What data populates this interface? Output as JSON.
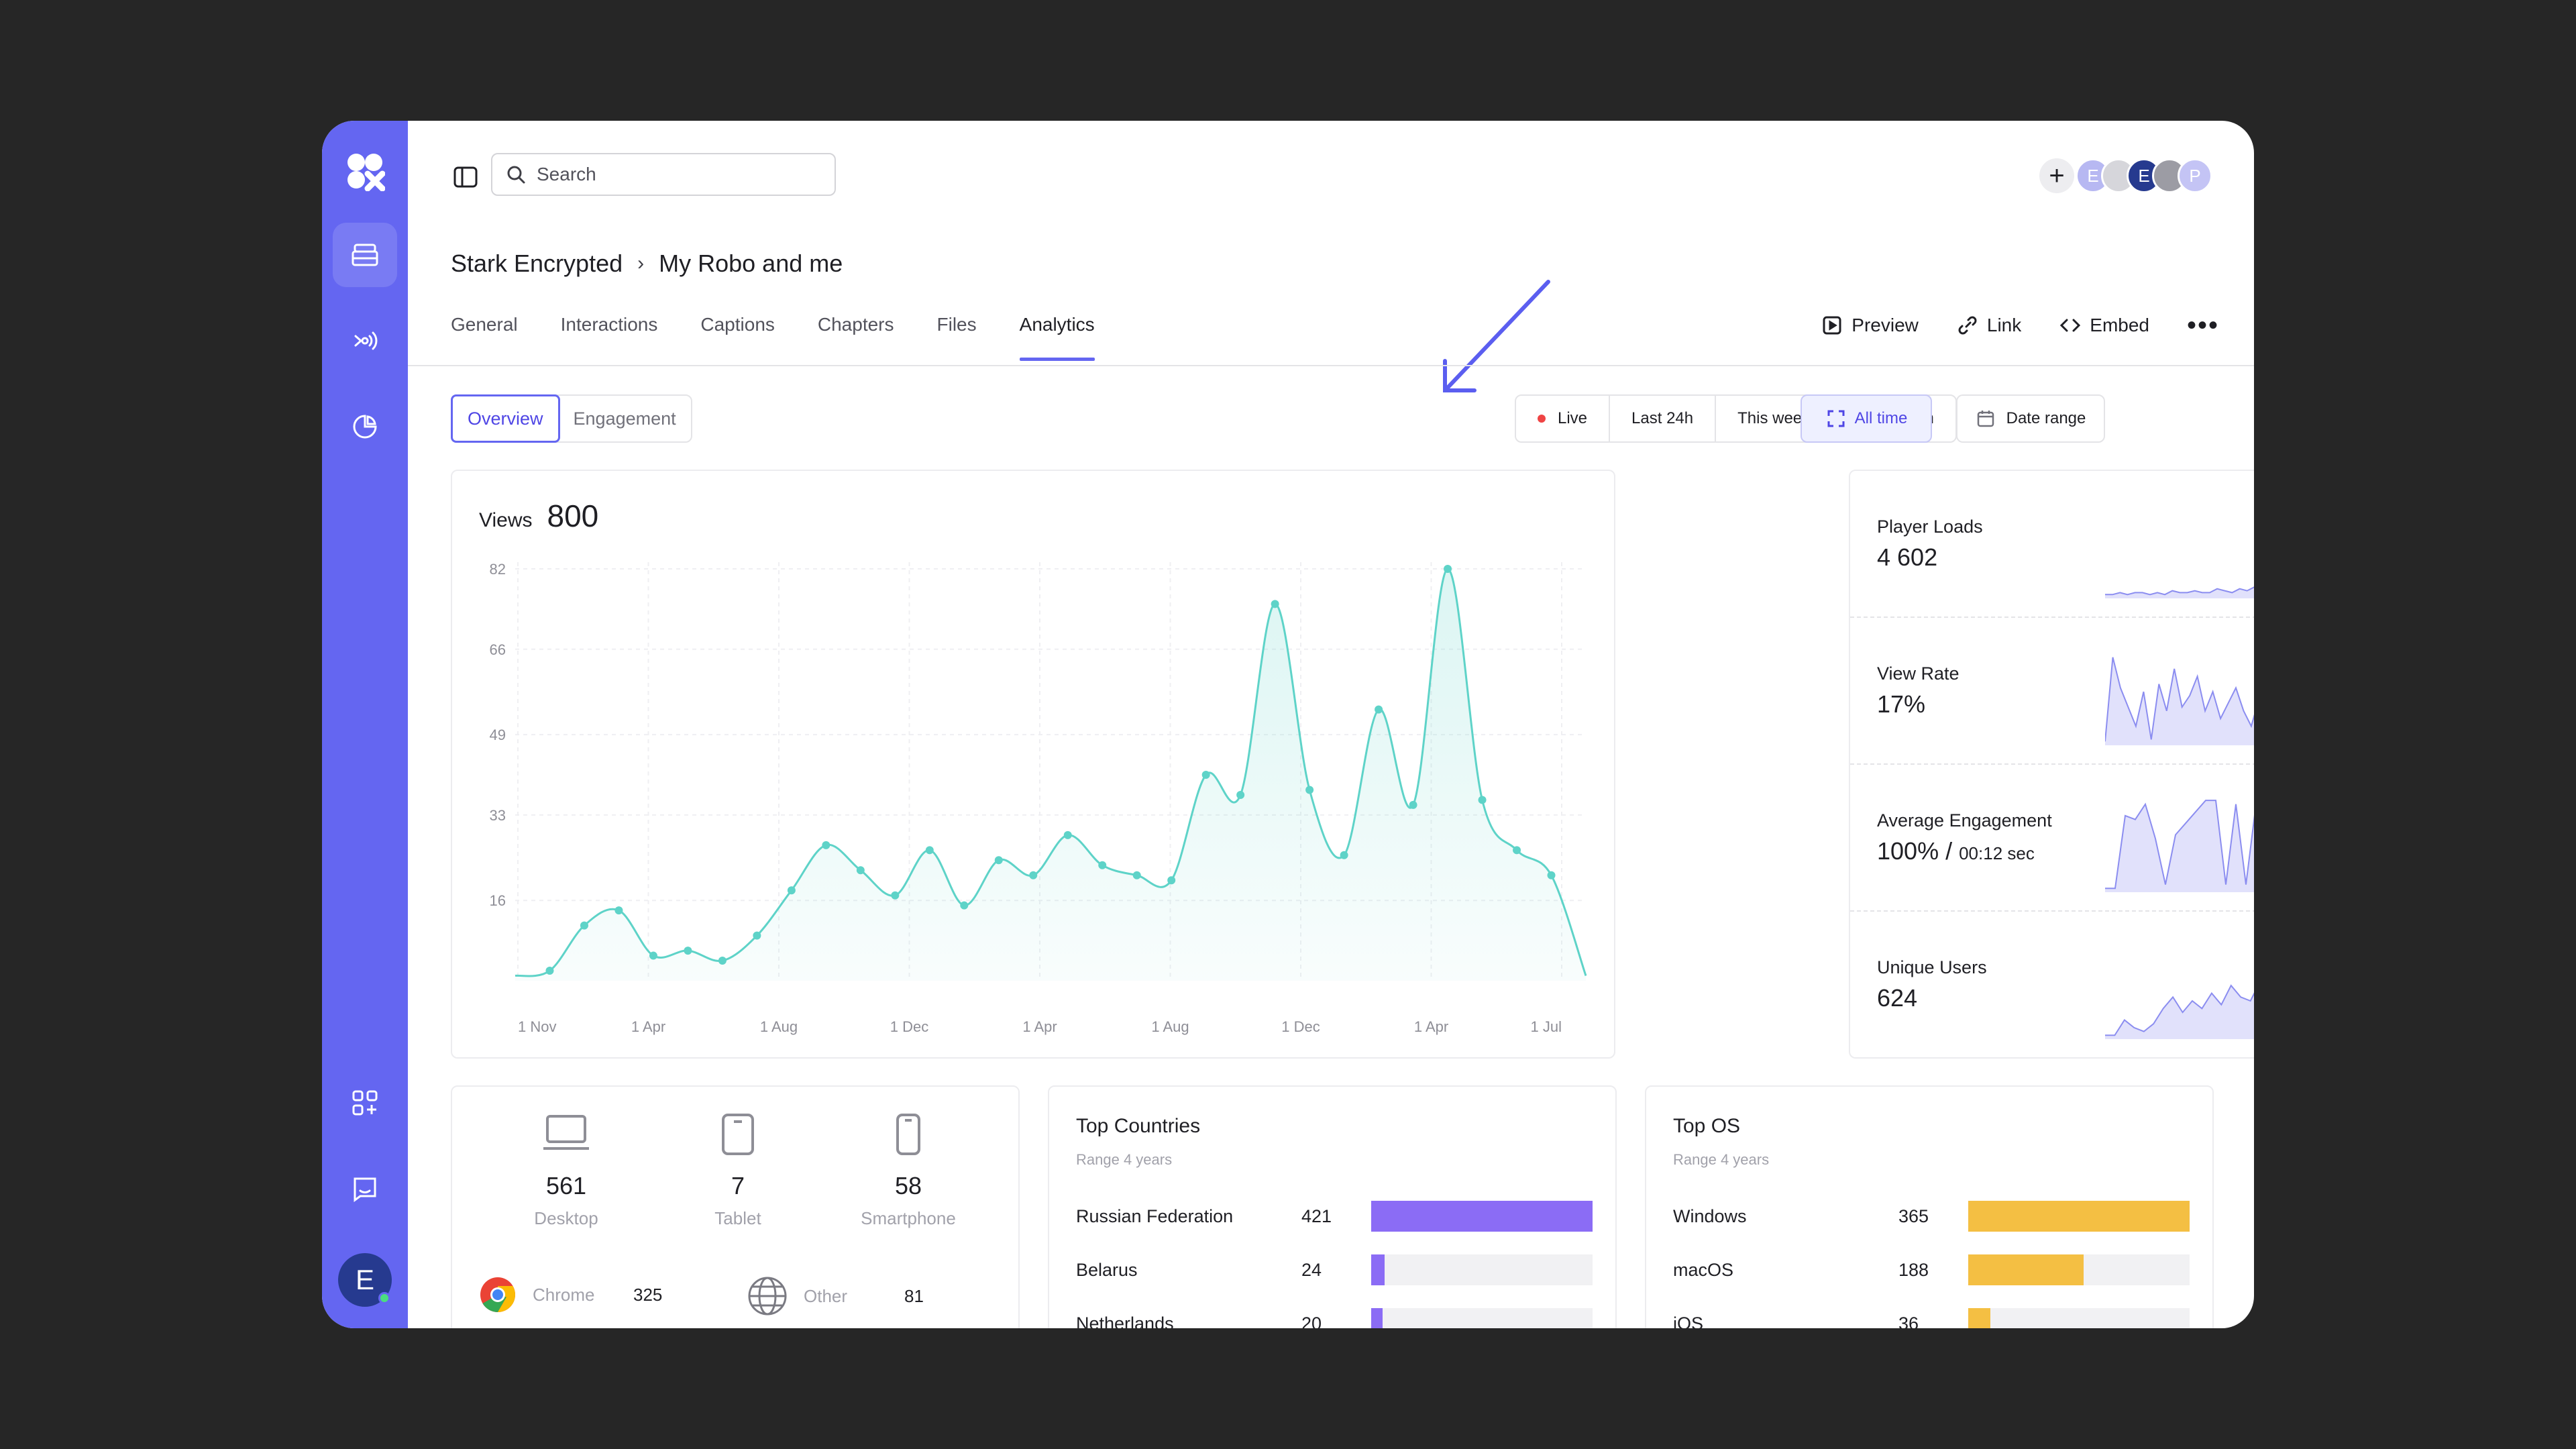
{
  "search": {
    "placeholder": "Search"
  },
  "collaborators": [
    "E",
    "E",
    "P"
  ],
  "breadcrumb": [
    "Stark Encrypted",
    "My Robo and me"
  ],
  "tabs": [
    "General",
    "Interactions",
    "Captions",
    "Chapters",
    "Files",
    "Analytics"
  ],
  "active_tab": "Analytics",
  "actions": {
    "preview": "Preview",
    "link": "Link",
    "embed": "Embed"
  },
  "subtabs": [
    "Overview",
    "Engagement"
  ],
  "ranges": [
    "Live",
    "Last 24h",
    "This week",
    "This month"
  ],
  "all_time": "All time",
  "date_range": "Date range",
  "user_initial": "E",
  "accent": "#6466f1",
  "views": {
    "label": "Views",
    "total": "800"
  },
  "chart_data": {
    "type": "area",
    "x_ticks": [
      "1 Nov",
      "1 Apr",
      "1 Aug",
      "1 Dec",
      "1 Apr",
      "1 Aug",
      "1 Dec",
      "1 Apr",
      "1 Jul"
    ],
    "y_ticks": [
      82,
      66,
      49,
      33,
      16
    ],
    "ylim": [
      0,
      82
    ],
    "values": [
      1,
      2,
      11,
      14,
      5,
      6,
      4,
      9,
      18,
      27,
      22,
      17,
      26,
      15,
      24,
      21,
      29,
      23,
      21,
      20,
      41,
      37,
      75,
      38,
      25,
      54,
      35,
      82,
      36,
      26,
      21,
      1
    ],
    "color": "#5ed3c8",
    "grid": true
  },
  "metrics": [
    {
      "label": "Player Loads",
      "value": "4 602",
      "suffix": ""
    },
    {
      "label": "View Rate",
      "value": "17%",
      "suffix": ""
    },
    {
      "label": "Average Engagement",
      "value": "100% /",
      "suffix": "00:12 sec"
    },
    {
      "label": "Unique Users",
      "value": "624",
      "suffix": ""
    }
  ],
  "devices": [
    {
      "count": "561",
      "label": "Desktop",
      "icon": "desktop-icon"
    },
    {
      "count": "7",
      "label": "Tablet",
      "icon": "tablet-icon"
    },
    {
      "count": "58",
      "label": "Smartphone",
      "icon": "smartphone-icon"
    }
  ],
  "browsers": [
    {
      "name": "Chrome",
      "count": "325",
      "icon": "chrome-icon"
    },
    {
      "name": "Other",
      "count": "81",
      "icon": "globe-icon"
    }
  ],
  "countries": {
    "title": "Top Countries",
    "subtitle": "Range 4 years",
    "color": "#8b6cf5",
    "rows": [
      {
        "name": "Russian Federation",
        "value": "421",
        "share": 1.0
      },
      {
        "name": "Belarus",
        "value": "24",
        "share": 0.06
      },
      {
        "name": "Netherlands",
        "value": "20",
        "share": 0.05
      }
    ]
  },
  "os": {
    "title": "Top OS",
    "subtitle": "Range 4 years",
    "color": "#f4bf43",
    "rows": [
      {
        "name": "Windows",
        "value": "365",
        "share": 1.0
      },
      {
        "name": "macOS",
        "value": "188",
        "share": 0.52
      },
      {
        "name": "iOS",
        "value": "36",
        "share": 0.1
      }
    ]
  }
}
